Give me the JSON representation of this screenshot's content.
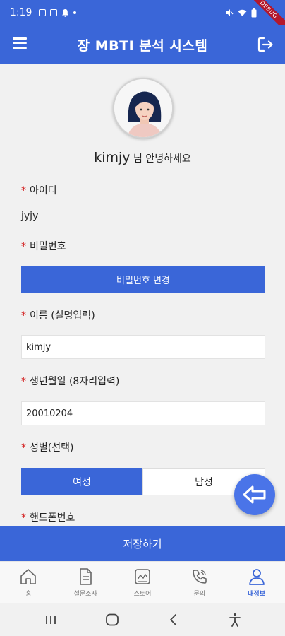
{
  "status_bar": {
    "time": "1:19",
    "debug": "DEBUG"
  },
  "app_bar": {
    "title": "장 MBTI 분석 시스템",
    "menu_icon": "menu-icon",
    "logout_icon": "logout-icon"
  },
  "profile": {
    "username": "kimjy",
    "greeting": " 님 안녕하세요"
  },
  "form": {
    "id_label": "아이디",
    "id_value": "jyjy",
    "password_label": "비밀번호",
    "password_button": "비밀번호 변경",
    "name_label": "이름 (실명입력)",
    "name_value": "kimjy",
    "birth_label": "생년월일 (8자리입력)",
    "birth_value": "20010204",
    "gender_label": "성별(선택)",
    "gender_female": "여성",
    "gender_male": "남성",
    "gender_selected": "여성",
    "phone_label": "핸드폰번호",
    "required_mark": "*"
  },
  "save_button": "저장하기",
  "bottom_nav": {
    "items": [
      {
        "label": "홈",
        "icon": "home-icon"
      },
      {
        "label": "설문조사",
        "icon": "survey-icon"
      },
      {
        "label": "스토어",
        "icon": "store-icon"
      },
      {
        "label": "문의",
        "icon": "phone-icon"
      },
      {
        "label": "내정보",
        "icon": "user-icon"
      }
    ],
    "active": "내정보"
  },
  "colors": {
    "primary": "#3a66d8",
    "required": "#d32020",
    "fab": "#4a74e8"
  }
}
